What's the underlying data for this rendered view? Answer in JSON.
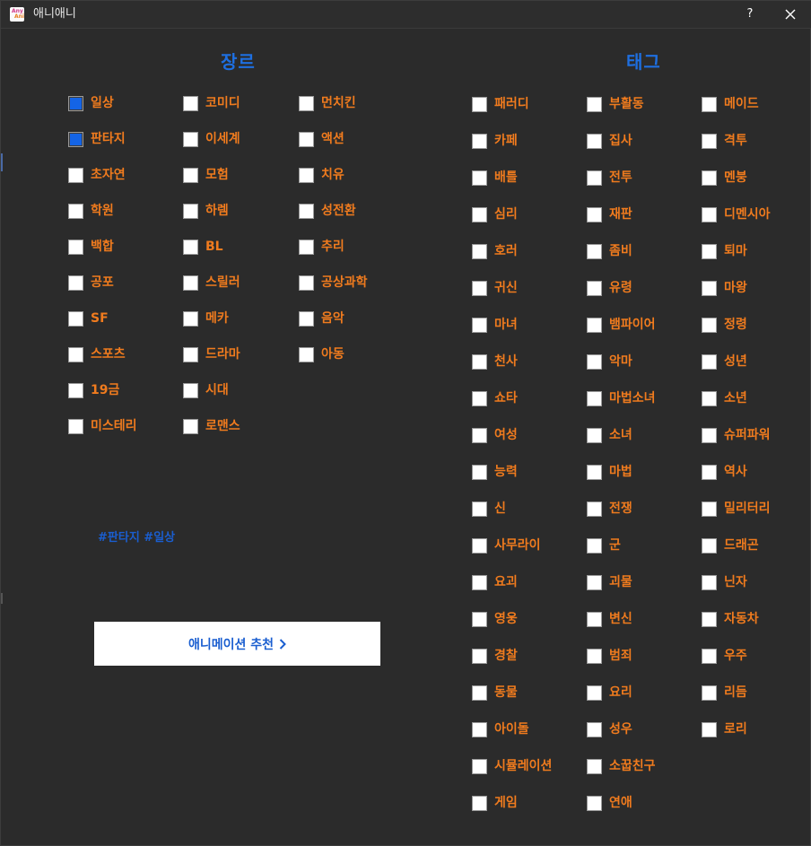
{
  "window": {
    "title": "애니애니",
    "help_label": "?",
    "app_icon_text_top": "Any",
    "app_icon_text_bottom": "Ani"
  },
  "colors": {
    "background": "#2b2b2b",
    "title_accent": "#1e6fe0",
    "label_orange": "#f07b1e",
    "checked_blue": "#1464e6",
    "hashtag_blue": "#1a5ed0"
  },
  "genre": {
    "title": "장르",
    "items": [
      {
        "label": "일상",
        "checked": true
      },
      {
        "label": "판타지",
        "checked": true
      },
      {
        "label": "초자연",
        "checked": false
      },
      {
        "label": "학원",
        "checked": false
      },
      {
        "label": "백합",
        "checked": false
      },
      {
        "label": "공포",
        "checked": false
      },
      {
        "label": "SF",
        "checked": false
      },
      {
        "label": "스포츠",
        "checked": false
      },
      {
        "label": "19금",
        "checked": false
      },
      {
        "label": "미스테리",
        "checked": false
      },
      {
        "label": "코미디",
        "checked": false
      },
      {
        "label": "이세계",
        "checked": false
      },
      {
        "label": "모험",
        "checked": false
      },
      {
        "label": "하렘",
        "checked": false
      },
      {
        "label": "BL",
        "checked": false
      },
      {
        "label": "스릴러",
        "checked": false
      },
      {
        "label": "메카",
        "checked": false
      },
      {
        "label": "드라마",
        "checked": false
      },
      {
        "label": "시대",
        "checked": false
      },
      {
        "label": "로맨스",
        "checked": false
      },
      {
        "label": "먼치킨",
        "checked": false
      },
      {
        "label": "액션",
        "checked": false
      },
      {
        "label": "치유",
        "checked": false
      },
      {
        "label": "성전환",
        "checked": false
      },
      {
        "label": "추리",
        "checked": false
      },
      {
        "label": "공상과학",
        "checked": false
      },
      {
        "label": "음악",
        "checked": false
      },
      {
        "label": "아동",
        "checked": false
      }
    ]
  },
  "selected_tags_text": "#판타지 #일상",
  "recommend_button": {
    "label": "애니메이션 추천"
  },
  "tag": {
    "title": "태그",
    "items": [
      {
        "label": "패러디",
        "checked": false
      },
      {
        "label": "카페",
        "checked": false
      },
      {
        "label": "배틀",
        "checked": false
      },
      {
        "label": "심리",
        "checked": false
      },
      {
        "label": "호러",
        "checked": false
      },
      {
        "label": "귀신",
        "checked": false
      },
      {
        "label": "마녀",
        "checked": false
      },
      {
        "label": "천사",
        "checked": false
      },
      {
        "label": "쇼타",
        "checked": false
      },
      {
        "label": "여성",
        "checked": false
      },
      {
        "label": "능력",
        "checked": false
      },
      {
        "label": "신",
        "checked": false
      },
      {
        "label": "사무라이",
        "checked": false
      },
      {
        "label": "요괴",
        "checked": false
      },
      {
        "label": "영웅",
        "checked": false
      },
      {
        "label": "경찰",
        "checked": false
      },
      {
        "label": "동물",
        "checked": false
      },
      {
        "label": "아이돌",
        "checked": false
      },
      {
        "label": "시뮬레이션",
        "checked": false
      },
      {
        "label": "게임",
        "checked": false
      },
      {
        "label": "부활동",
        "checked": false
      },
      {
        "label": "집사",
        "checked": false
      },
      {
        "label": "전투",
        "checked": false
      },
      {
        "label": "재판",
        "checked": false
      },
      {
        "label": "좀비",
        "checked": false
      },
      {
        "label": "유령",
        "checked": false
      },
      {
        "label": "뱀파이어",
        "checked": false
      },
      {
        "label": "악마",
        "checked": false
      },
      {
        "label": "마법소녀",
        "checked": false
      },
      {
        "label": "소녀",
        "checked": false
      },
      {
        "label": "마법",
        "checked": false
      },
      {
        "label": "전쟁",
        "checked": false
      },
      {
        "label": "군",
        "checked": false
      },
      {
        "label": "괴물",
        "checked": false
      },
      {
        "label": "변신",
        "checked": false
      },
      {
        "label": "범죄",
        "checked": false
      },
      {
        "label": "요리",
        "checked": false
      },
      {
        "label": "성우",
        "checked": false
      },
      {
        "label": "소꿉친구",
        "checked": false
      },
      {
        "label": "연애",
        "checked": false
      },
      {
        "label": "메이드",
        "checked": false
      },
      {
        "label": "격투",
        "checked": false
      },
      {
        "label": "멘붕",
        "checked": false
      },
      {
        "label": "디멘시아",
        "checked": false
      },
      {
        "label": "퇴마",
        "checked": false
      },
      {
        "label": "마왕",
        "checked": false
      },
      {
        "label": "정령",
        "checked": false
      },
      {
        "label": "성년",
        "checked": false
      },
      {
        "label": "소년",
        "checked": false
      },
      {
        "label": "슈퍼파워",
        "checked": false
      },
      {
        "label": "역사",
        "checked": false
      },
      {
        "label": "밀리터리",
        "checked": false
      },
      {
        "label": "드래곤",
        "checked": false
      },
      {
        "label": "닌자",
        "checked": false
      },
      {
        "label": "자동차",
        "checked": false
      },
      {
        "label": "우주",
        "checked": false
      },
      {
        "label": "리듬",
        "checked": false
      },
      {
        "label": "로리",
        "checked": false
      }
    ]
  }
}
